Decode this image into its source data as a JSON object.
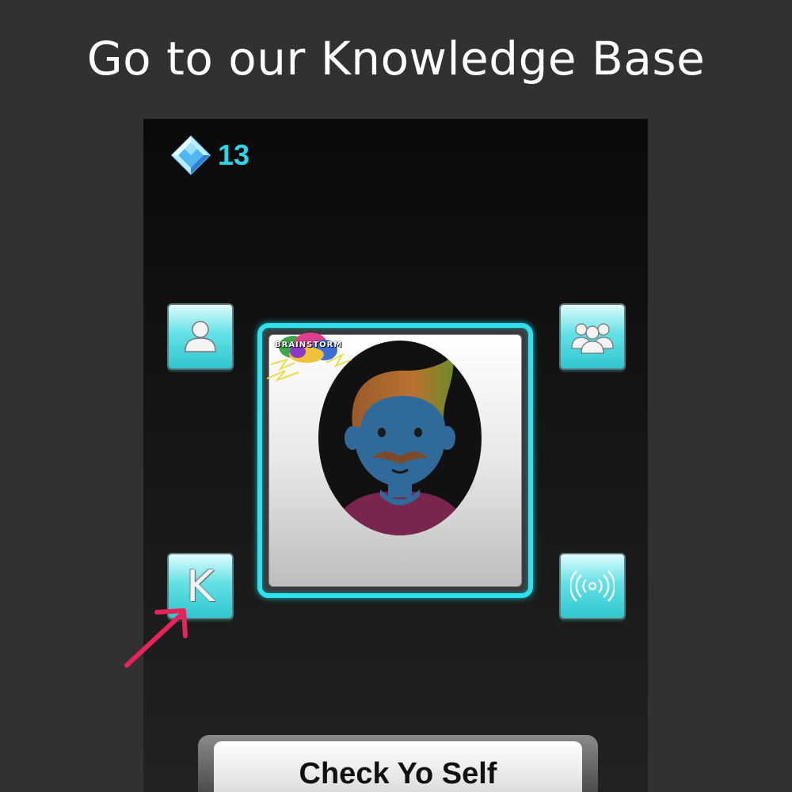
{
  "headline": "Go to our Knowledge Base",
  "gems": {
    "icon": "diamond-gem-icon",
    "count": "13"
  },
  "buttons": {
    "profile": {
      "icon": "single-user-icon"
    },
    "group": {
      "icon": "users-group-icon"
    },
    "knowledge": {
      "icon": "knowledge-base-icon",
      "letter": "K"
    },
    "broadcast": {
      "icon": "broadcast-signal-icon"
    }
  },
  "avatar": {
    "icon": "man-with-mustache-avatar",
    "brand_logo": "BRAINSTORM"
  },
  "check_button": {
    "label": "Check Yo Self"
  },
  "annotation": {
    "icon": "pink-arrow-icon",
    "color": "#e8235a"
  },
  "colors": {
    "accent": "#2fe0ee",
    "gem_text": "#2ad7e8",
    "button_face": "#64e1e6",
    "background": "#313131"
  }
}
